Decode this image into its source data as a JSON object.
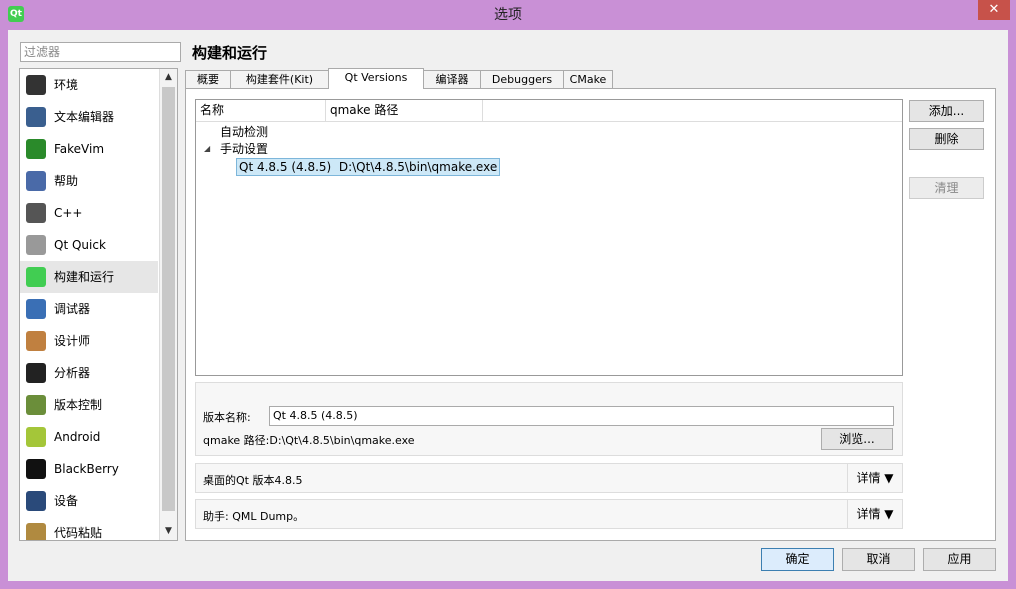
{
  "window": {
    "title": "选项",
    "close_label": "✕",
    "app_icon_label": "Qt"
  },
  "filter": {
    "placeholder": "过滤器"
  },
  "sidebar": {
    "items": [
      {
        "label": "环境",
        "icon": "monitor-icon",
        "color": "#333333"
      },
      {
        "label": "文本编辑器",
        "icon": "document-icon",
        "color": "#3a5f8f"
      },
      {
        "label": "FakeVim",
        "icon": "fakevim-icon",
        "color": "#2a8a2a"
      },
      {
        "label": "帮助",
        "icon": "help-icon",
        "color": "#4a6aa8"
      },
      {
        "label": "C++",
        "icon": "braces-icon",
        "color": "#555555"
      },
      {
        "label": "Qt Quick",
        "icon": "paper-plane-icon",
        "color": "#999999"
      },
      {
        "label": "构建和运行",
        "icon": "qt-build-icon",
        "color": "#41cd52"
      },
      {
        "label": "调试器",
        "icon": "debugger-icon",
        "color": "#3a6fb5"
      },
      {
        "label": "设计师",
        "icon": "designer-icon",
        "color": "#c08040"
      },
      {
        "label": "分析器",
        "icon": "analyzer-icon",
        "color": "#222222"
      },
      {
        "label": "版本控制",
        "icon": "version-control-icon",
        "color": "#6b8e3a"
      },
      {
        "label": "Android",
        "icon": "android-icon",
        "color": "#a4c639"
      },
      {
        "label": "BlackBerry",
        "icon": "blackberry-icon",
        "color": "#111111"
      },
      {
        "label": "设备",
        "icon": "device-icon",
        "color": "#2a4a7a"
      },
      {
        "label": "代码粘贴",
        "icon": "paste-icon",
        "color": "#b08a40"
      }
    ],
    "active_index": 6
  },
  "page": {
    "title": "构建和运行"
  },
  "tabs": [
    "概要",
    "构建套件(Kit)",
    "Qt Versions",
    "编译器",
    "Debuggers",
    "CMake"
  ],
  "active_tab": 2,
  "tree": {
    "columns": [
      "名称",
      "qmake 路径"
    ],
    "auto_group": "自动检测",
    "manual_group": "手动设置",
    "selected_name": "Qt 4.8.5 (4.8.5)",
    "selected_path": "D:\\Qt\\4.8.5\\bin\\qmake.exe"
  },
  "actions": {
    "add": "添加...",
    "remove": "删除",
    "clean": "清理"
  },
  "details": {
    "version_name_label": "版本名称:",
    "version_name_value": "Qt 4.8.5 (4.8.5)",
    "qmake_path_label": "qmake 路径:D:\\Qt\\4.8.5\\bin\\qmake.exe",
    "browse": "浏览..."
  },
  "info_rows": [
    {
      "text": "桌面的Qt 版本4.8.5",
      "button": "详情 ▼"
    },
    {
      "text": "助手: QML Dump。",
      "button": "详情 ▼"
    }
  ],
  "dialog_buttons": {
    "ok": "确定",
    "cancel": "取消",
    "apply": "应用"
  }
}
